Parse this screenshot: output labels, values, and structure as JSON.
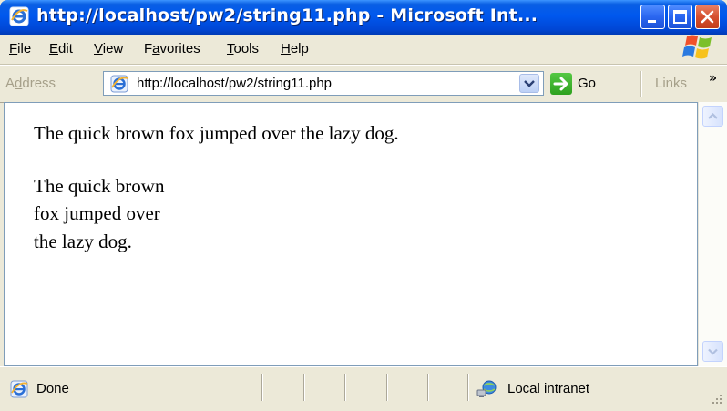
{
  "window": {
    "title": "http://localhost/pw2/string11.php - Microsoft Int...",
    "colors": {
      "titlebar": "#0058ee",
      "close": "#d6502f",
      "chrome": "#ece9d8"
    }
  },
  "menu": {
    "items": [
      {
        "first": "F",
        "rest": "ile"
      },
      {
        "first": "E",
        "rest": "dit"
      },
      {
        "first": "V",
        "rest": "iew"
      },
      {
        "pre": "F",
        "first": "a",
        "rest": "vorites"
      },
      {
        "first": "T",
        "rest": "ools"
      },
      {
        "first": "H",
        "rest": "elp"
      }
    ]
  },
  "address": {
    "label_pre": "A",
    "label_ul": "d",
    "label_rest": "dress",
    "url": "http://localhost/pw2/string11.php",
    "go_label": "Go",
    "links_label": "Links",
    "links_chevron": "»"
  },
  "content": {
    "lines": [
      "The quick brown fox jumped over the lazy dog.",
      "The quick brown",
      "fox jumped over",
      "the lazy dog."
    ]
  },
  "status": {
    "text": "Done",
    "zone": "Local intranet"
  },
  "icons": {
    "title": "ie-icon",
    "address": "ie-page-icon",
    "status": "ie-page-icon",
    "zone": "local-intranet-icon",
    "flag": "windows-flag-icon"
  }
}
